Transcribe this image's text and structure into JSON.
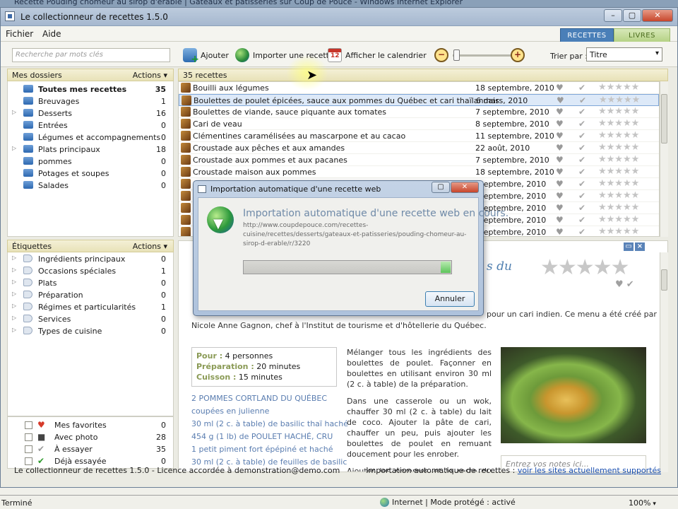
{
  "ie": {
    "title": "Recette Pouding chômeur au sirop d'érable | Gâteaux et pâtisseries sur Coup de Pouce - Windows Internet Explorer",
    "status_left": "Terminé",
    "zone": "Internet | Mode protégé : activé",
    "zoom": "100%"
  },
  "window": {
    "title": "Le collectionneur de recettes 1.5.0",
    "minimize": "–",
    "maximize": "▢",
    "close": "✕"
  },
  "menu": {
    "file": "Fichier",
    "help": "Aide"
  },
  "top_tabs": {
    "recipes": "RECETTES",
    "books": "LIVRES"
  },
  "toolbar": {
    "search_placeholder": "Recherche par mots clés",
    "add": "Ajouter",
    "import": "Importer une recette",
    "calendar": "Afficher le calendrier",
    "zoom_out": "−",
    "zoom_in": "+",
    "sort_label": "Trier par :",
    "sort_value": "Titre"
  },
  "folders": {
    "title": "Mes dossiers",
    "actions": "Actions",
    "items": [
      {
        "label": "Toutes mes recettes",
        "count": "35"
      },
      {
        "label": "Breuvages",
        "count": "1"
      },
      {
        "label": "Desserts",
        "count": "16"
      },
      {
        "label": "Entrées",
        "count": "0"
      },
      {
        "label": "Légumes et accompagnements",
        "count": "0"
      },
      {
        "label": "Plats principaux",
        "count": "18"
      },
      {
        "label": "pommes",
        "count": "0"
      },
      {
        "label": "Potages et soupes",
        "count": "0"
      },
      {
        "label": "Salades",
        "count": "0"
      }
    ]
  },
  "tags": {
    "title": "Étiquettes",
    "actions": "Actions",
    "items": [
      {
        "label": "Ingrédients principaux",
        "count": "0"
      },
      {
        "label": "Occasions spéciales",
        "count": "1"
      },
      {
        "label": "Plats",
        "count": "0"
      },
      {
        "label": "Préparation",
        "count": "0"
      },
      {
        "label": "Régimes et particularités",
        "count": "1"
      },
      {
        "label": "Services",
        "count": "0"
      },
      {
        "label": "Types de cuisine",
        "count": "0"
      }
    ]
  },
  "favorites": [
    {
      "label": "Mes favorites",
      "count": "0",
      "icon": "heart-icon"
    },
    {
      "label": "Avec photo",
      "count": "28",
      "icon": "camera-icon"
    },
    {
      "label": "À essayer",
      "count": "35",
      "icon": "check-gray-icon"
    },
    {
      "label": "Déjà essayée",
      "count": "0",
      "icon": "check-green-icon"
    }
  ],
  "list": {
    "count_label": "35 recettes",
    "rows": [
      {
        "name": "Bouilli aux légumes",
        "date": "18 septembre, 2010"
      },
      {
        "name": "Boulettes de poulet épicées, sauce aux pommes du Québec et cari thaïlandais",
        "date": "6 mars, 2010"
      },
      {
        "name": "Boulettes de viande, sauce piquante aux tomates",
        "date": "7 septembre, 2010"
      },
      {
        "name": "Cari de veau",
        "date": "8 septembre, 2010"
      },
      {
        "name": "Clémentines caramélisées au mascarpone et au cacao",
        "date": "11 septembre, 2010"
      },
      {
        "name": "Croustade aux pêches  et aux amandes",
        "date": "22 août, 2010"
      },
      {
        "name": "Croustade aux pommes et aux pacanes",
        "date": "7 septembre, 2010"
      },
      {
        "name": "Croustade maison aux pommes",
        "date": "18 septembre, 2010"
      },
      {
        "name": "",
        "date": "septembre, 2010"
      },
      {
        "name": "",
        "date": "septembre, 2010"
      },
      {
        "name": "",
        "date": "septembre, 2010"
      },
      {
        "name": "",
        "date": "septembre, 2010"
      },
      {
        "name": "",
        "date": "septembre, 2010"
      }
    ],
    "stars": "★★★★★",
    "heart": "♥",
    "check": "✔"
  },
  "preview": {
    "title_fragment": "s du",
    "stars": "★★★★★",
    "intro_a": "pour un cari indien. Ce menu a été créé par",
    "intro_b": "Nicole Anne Gagnon, chef à l'Institut de tourisme et d'hôtellerie du Québec.",
    "portions_k": "Pour :",
    "portions_v": " 4 personnes",
    "prep_k": "Préparation :",
    "prep_v": " 20 minutes",
    "cook_k": "Cuisson :",
    "cook_v": " 15 minutes",
    "ingredients": [
      "2 POMMES CORTLAND DU QUÉBEC",
      "coupées en julienne",
      "30 ml (2 c. à table) de basilic thaï haché",
      "454 g (1 lb) de POULET HACHÉ, CRU",
      "1 petit piment fort épépiné et haché",
      "30 ml (2 c. à table) de feuilles de basilic"
    ],
    "steps": [
      "Mélanger tous les ingrédients des boulettes de poulet. Façonner en boulettes en utilisant environ 30 ml (2 c. à table) de la préparation.",
      "Dans une casserole ou un wok, chauffer 30 ml (2 c. à table) du lait de coco. Ajouter la pâte de cari, chauffer un peu, puis ajouter les boulettes de poulet en remuant doucement pour les enrober.",
      "Ajouter les pommes et le reste du lait"
    ],
    "notes_placeholder": "Entrez vos notes ici..."
  },
  "dialog": {
    "title": "Importation automatique d'une recette web",
    "heading": "Importation automatique d'une recette web en cours.",
    "url": "http://www.coupdepouce.com/recettes-cuisine/recettes/desserts/gateaux-et-patisseries/pouding-chomeur-au-sirop-d-erable/r/3220",
    "progress": 1.0,
    "cancel": "Annuler"
  },
  "app_status": {
    "left": "Le collectionneur de recettes 1.5.0 - Licence accordée à demonstration@demo.com",
    "right_label": "Importation automatique de recettes :",
    "right_link": "voir les sites actuellement supportés"
  }
}
